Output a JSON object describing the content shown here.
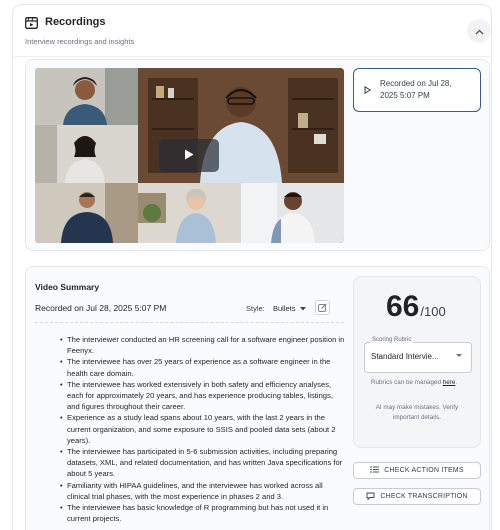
{
  "header": {
    "title": "Recordings",
    "subtitle": "Interview recordings and insights",
    "collapse_icon": "chevron-up-icon"
  },
  "recording": {
    "label_line1": "Recorded on Jul 28,",
    "label_line2": "2025 5:07 PM",
    "play_icon": "play-icon"
  },
  "summary": {
    "title": "Video Summary",
    "recorded": "Recorded on Jul 28, 2025 5:07 PM",
    "style_label": "Style:",
    "style_value": "Bullets",
    "bullets": [
      "The interviewer conducted an HR screening call for a software engineer position in Feenyx.",
      "The interviewee has over 25 years of experience as a software engineer in the health care domain.",
      "The interviewee has worked extensively in both safety and efficiency analyses, each for approximately 20 years, and has experience producing tables, listings, and figures throughout their career.",
      "Experience as a study lead spans about 10 years, with the last 2 years in the current organization, and some exposure to SSIS and pooled data sets (about 2 years).",
      "The interviewee has participated in 5-6 submission activities, including preparing datasets, XML, and related documentation, and has written Java specifications for about 5 years.",
      "Familiarity with HIPAA guidelines, and the interviewee has worked across all clinical trial phases, with the most experience in phases 2 and 3.",
      "The interviewee has basic knowledge of R programming but has not used it in current projects."
    ]
  },
  "score": {
    "value": "66",
    "max": "/100",
    "rubric_label": "Scoring Rubric",
    "rubric_value": "Standard Intervie...",
    "rubric_note": "Rubrics can be managed",
    "rubric_link": "here",
    "ai_note": "AI may make mistakes. Verify important details."
  },
  "actions": {
    "check_action_items": "CHECK ACTION ITEMS",
    "check_transcription": "CHECK TRANSCRIPTION"
  },
  "colors": {
    "accent_border": "#3b5b8c",
    "card_bg": "#fafbfc"
  }
}
